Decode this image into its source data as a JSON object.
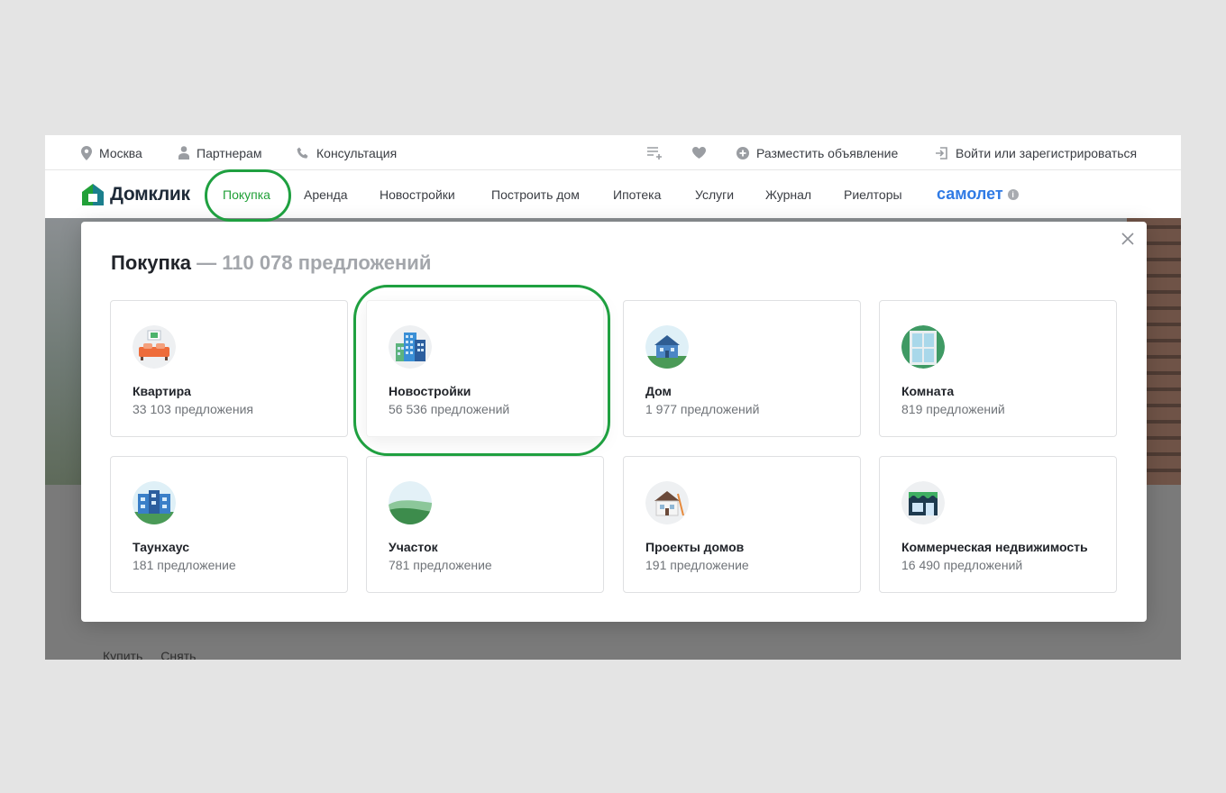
{
  "topbar": {
    "city": "Москва",
    "partners": "Партнерам",
    "consult": "Консультация",
    "post_ad": "Разместить объявление",
    "login": "Войти или зарегистрироваться"
  },
  "logo": {
    "text": "Домклик"
  },
  "nav": {
    "items": [
      "Покупка",
      "Аренда",
      "Новостройки",
      "Построить дом",
      "Ипотека",
      "Услуги",
      "Журнал",
      "Риелторы"
    ],
    "active": "Покупка",
    "partner_brand": "самолет"
  },
  "modal": {
    "title": "Покупка",
    "separator": "—",
    "count": "110 078 предложений",
    "cards": [
      {
        "title": "Квартира",
        "sub": "33 103 предложения",
        "icon": "apartment-icon"
      },
      {
        "title": "Новостройки",
        "sub": "56 536 предложений",
        "icon": "new-buildings-icon"
      },
      {
        "title": "Дом",
        "sub": "1 977 предложений",
        "icon": "house-icon"
      },
      {
        "title": "Комната",
        "sub": "819 предложений",
        "icon": "room-icon"
      },
      {
        "title": "Таунхаус",
        "sub": "181 предложение",
        "icon": "townhouse-icon"
      },
      {
        "title": "Участок",
        "sub": "781 предложение",
        "icon": "land-plot-icon"
      },
      {
        "title": "Проекты домов",
        "sub": "191 предложение",
        "icon": "house-project-icon"
      },
      {
        "title": "Коммерческая недвижимость",
        "sub": "16 490 предложений",
        "icon": "commercial-icon"
      }
    ]
  },
  "bottom_tabs": [
    "Купить",
    "Снять"
  ],
  "colors": {
    "accent": "#21a038",
    "brand_blue": "#2f7ae5",
    "highlight_ring": "#1fa040"
  }
}
